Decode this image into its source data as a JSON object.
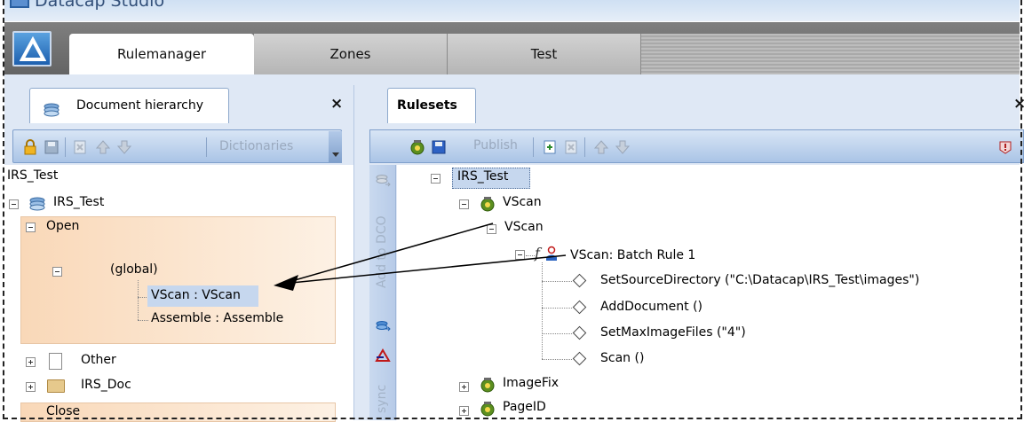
{
  "app": {
    "title": "Datacap Studio"
  },
  "tabs": [
    {
      "label": "Rulemanager",
      "active": true
    },
    {
      "label": "Zones",
      "active": false
    },
    {
      "label": "Test",
      "active": false
    }
  ],
  "left_pane": {
    "tab_label": "Document hierarchy",
    "close_glyph": "×",
    "toolbar": {
      "dictionaries_label": "Dictionaries"
    },
    "tree": {
      "root_label": "IRS_Test",
      "doc_root": "IRS_Test",
      "open_label": "Open",
      "global_label": "(global)",
      "items": [
        "VScan : VScan",
        "Assemble : Assemble"
      ],
      "other_label": "Other",
      "irs_doc_label": "IRS_Doc",
      "close_label": "Close"
    }
  },
  "right_pane": {
    "tab_label": "Rulesets",
    "close_glyph": "×",
    "toolbar": {
      "publish_label": "Publish"
    },
    "side_labels": {
      "add_to_dco": "Add to DCO",
      "sync": "sync"
    },
    "tree": {
      "root": "IRS_Test",
      "ruleset": "VScan",
      "rule": "VScan",
      "function": "VScan: Batch Rule 1",
      "actions": [
        "SetSourceDirectory (\"C:\\Datacap\\IRS_Test\\images\")",
        "AddDocument ()",
        "SetMaxImageFiles (\"4\")",
        "Scan ()"
      ],
      "more_rulesets": [
        "ImageFix",
        "PageID"
      ]
    }
  },
  "colors": {
    "accent": "#1d5fae",
    "toolbar": "#aac4e6",
    "selection": "#c6d7ee",
    "open_highlight": "#f9d8b8",
    "tab_band": "#6f6f6f"
  }
}
